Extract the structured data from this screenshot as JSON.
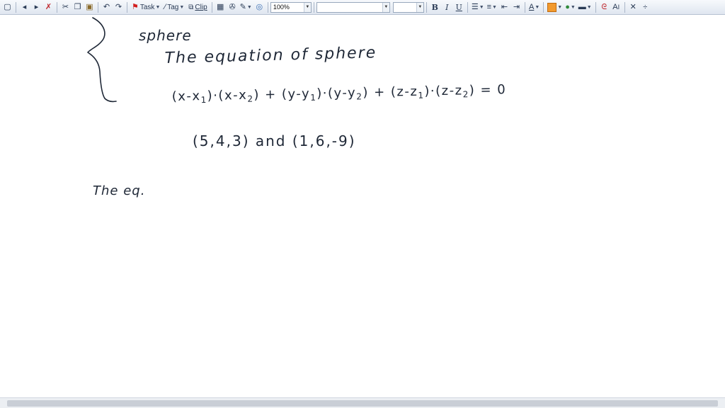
{
  "toolbar": {
    "task_label": "Task",
    "tag_label": "Tag",
    "clip_label": "Clip",
    "zoom_value": "100%",
    "font_name_value": "",
    "font_size_value": "",
    "bold_label": "B",
    "italic_label": "I",
    "underline_label": "U",
    "font_color_label": "A",
    "text_size_label": "A",
    "colors": {
      "highlighter": "#f29a2e",
      "flag": "#d21f1f"
    }
  },
  "note": {
    "line_sphere": "sphere",
    "line_title": "The equation of sphere",
    "formula": {
      "p1_open": "(x-x",
      "s1": "1",
      "p1_mid": ")·(x-x",
      "s2": "2",
      "p2_join": ") + (y-y",
      "s3": "1",
      "p2_mid": ")·(y-y",
      "s4": "2",
      "p3_join": ") + (z-z",
      "s5": "1",
      "p3_mid": ")·(z-z",
      "s6": "2",
      "tail": ") = 0"
    },
    "line_points": "(5,4,3)  and  (1,6,-9)",
    "line_eq_start": "The eq."
  }
}
